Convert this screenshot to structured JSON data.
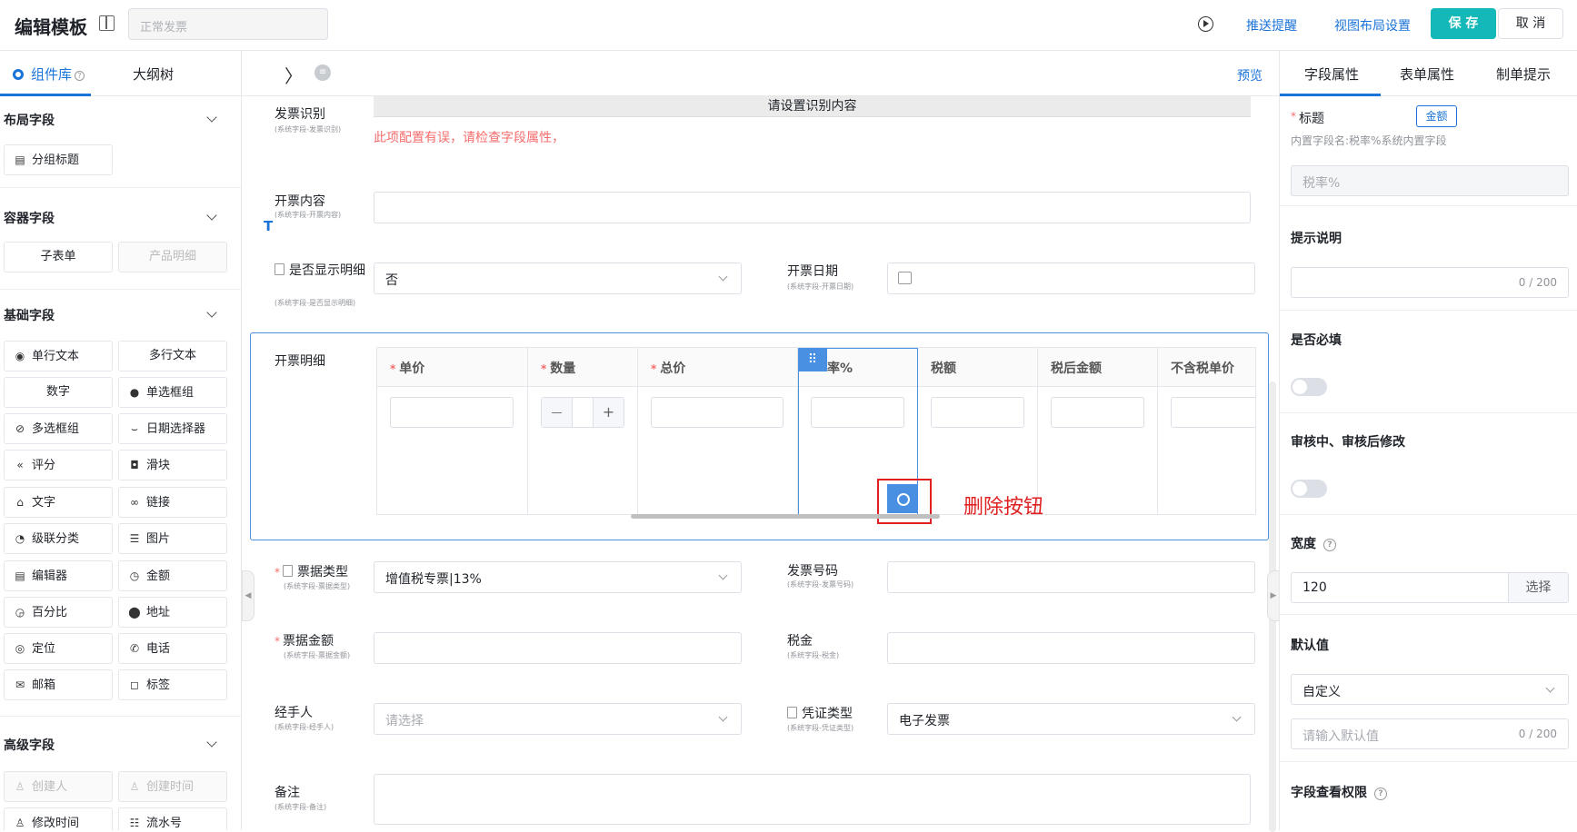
{
  "header": {
    "title": "编辑模板",
    "template_placeholder": "正常发票",
    "push_reminder": "推送提醒",
    "view_layout": "视图布局设置",
    "save": "保 存",
    "cancel": "取 消"
  },
  "left_panel": {
    "tabs": [
      "组件库",
      "大纲树"
    ],
    "sections": [
      {
        "title": "布局字段",
        "items": [
          {
            "label": "分组标题",
            "icon": "heading-icon"
          }
        ]
      },
      {
        "title": "容器字段",
        "items": [
          {
            "label": "子表单",
            "icon": ""
          },
          {
            "label": "产品明细",
            "icon": "",
            "disabled": true
          }
        ]
      },
      {
        "title": "基础字段",
        "items": [
          {
            "label": "单行文本",
            "icon": "single-line-text-icon"
          },
          {
            "label": "多行文本",
            "icon": ""
          },
          {
            "label": "数字",
            "icon": ""
          },
          {
            "label": "单选框组",
            "icon": "radio-icon"
          },
          {
            "label": "多选框组",
            "icon": "checkbox-icon"
          },
          {
            "label": "日期选择器",
            "icon": "date-icon"
          },
          {
            "label": "评分",
            "icon": "rating-icon"
          },
          {
            "label": "滑块",
            "icon": "slider-icon"
          },
          {
            "label": "文字",
            "icon": "text-icon"
          },
          {
            "label": "链接",
            "icon": "link-icon"
          },
          {
            "label": "级联分类",
            "icon": "cascade-icon"
          },
          {
            "label": "图片",
            "icon": "image-icon"
          },
          {
            "label": "编辑器",
            "icon": "editor-icon"
          },
          {
            "label": "金额",
            "icon": "amount-icon"
          },
          {
            "label": "百分比",
            "icon": "percent-icon"
          },
          {
            "label": "地址",
            "icon": "location-icon"
          },
          {
            "label": "定位",
            "icon": "locate-icon"
          },
          {
            "label": "电话",
            "icon": "phone-icon"
          },
          {
            "label": "邮箱",
            "icon": "mail-icon"
          },
          {
            "label": "标签",
            "icon": "tag-icon"
          }
        ]
      },
      {
        "title": "高级字段",
        "items": [
          {
            "label": "创建人",
            "icon": "user-icon",
            "disabled": true
          },
          {
            "label": "创建时间",
            "icon": "user-icon",
            "disabled": true
          },
          {
            "label": "修改时间",
            "icon": "user-icon"
          },
          {
            "label": "流水号",
            "icon": "list-icon"
          }
        ]
      }
    ]
  },
  "canvas": {
    "preview": "预览",
    "invoice_id": {
      "label": "发票识别",
      "sub": "(系统字段-发票识别)",
      "bar": "请设置识别内容",
      "error": "此项配置有误，请检查字段属性，"
    },
    "invoice_content": {
      "label": "开票内容",
      "sub": "(系统字段-开票内容)"
    },
    "show_detail": {
      "label": "是否显示明细",
      "sub": "(系统字段-是否显示明细)",
      "value": "否"
    },
    "invoice_date": {
      "label": "开票日期",
      "sub": "(系统字段-开票日期)"
    },
    "detail": {
      "label": "开票明细",
      "columns": [
        "单价",
        "数量",
        "总价",
        "率%",
        "税额",
        "税后金额",
        "不含税单价"
      ],
      "required": [
        true,
        true,
        true,
        false,
        false,
        false,
        false
      ],
      "stepper_minus": "—",
      "stepper_plus": "+"
    },
    "annotation": "删除按钮",
    "receipt_type": {
      "label": "票据类型",
      "sub": "(系统字段-票据类型)",
      "value": "增值税专票|13%"
    },
    "invoice_no": {
      "label": "发票号码",
      "sub": "(系统字段-发票号码)"
    },
    "receipt_amount": {
      "label": "票据金额",
      "sub": "(系统字段-票据金额)"
    },
    "tax": {
      "label": "税金",
      "sub": "(系统字段-税金)"
    },
    "handler": {
      "label": "经手人",
      "sub": "(系统字段-经手人)",
      "placeholder": "请选择"
    },
    "voucher_type": {
      "label": "凭证类型",
      "sub": "(系统字段-凭证类型)",
      "value": "电子发票"
    },
    "remark": {
      "label": "备注",
      "sub": "(系统字段-备注)"
    }
  },
  "right_panel": {
    "tabs": [
      "字段属性",
      "表单属性",
      "制单提示"
    ],
    "title_label": "标题",
    "title_tag": "金额",
    "title_note": "内置字段名:税率%系统内置字段",
    "title_value": "税率%",
    "hint_label": "提示说明",
    "hint_count": "0 / 200",
    "required_label": "是否必填",
    "modify_label": "审核中、审核后修改",
    "width_label": "宽度",
    "width_value": "120",
    "width_select": "选择",
    "default_label": "默认值",
    "default_mode": "自定义",
    "default_placeholder": "请输入默认值",
    "default_count": "0 / 200",
    "permission_label": "字段查看权限"
  }
}
